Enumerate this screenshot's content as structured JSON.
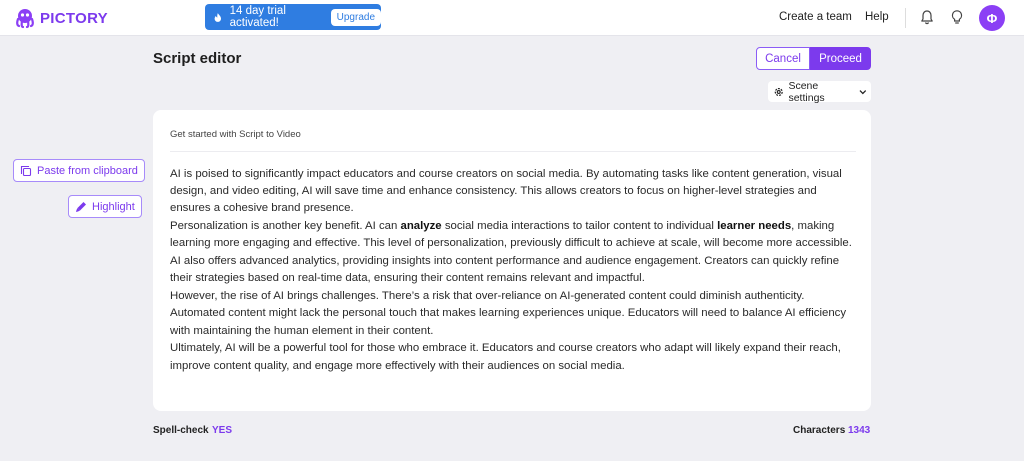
{
  "header": {
    "brand": "PICTORY",
    "trial_text": "14 day trial activated!",
    "upgrade_label": "Upgrade",
    "create_team_label": "Create a team",
    "help_label": "Help",
    "avatar_initial": "Φ"
  },
  "page": {
    "title": "Script editor",
    "cancel_label": "Cancel",
    "proceed_label": "Proceed",
    "scene_settings_label": "Scene settings"
  },
  "sidebar": {
    "paste_label": "Paste from clipboard",
    "highlight_label": "Highlight"
  },
  "editor": {
    "heading": "Get started with Script to Video",
    "paragraphs": [
      [
        {
          "text": "AI is poised to significantly impact educators and course creators on social media. By automating tasks like content generation, visual design, and video editing, AI will save time and enhance consistency. This allows creators to focus on higher-level strategies and ensures a cohesive brand presence.",
          "bold": false
        }
      ],
      [
        {
          "text": "Personalization is another key benefit. AI can ",
          "bold": false
        },
        {
          "text": "analyze",
          "bold": true
        },
        {
          "text": " social media interactions to tailor content to individual ",
          "bold": false
        },
        {
          "text": "learner needs",
          "bold": true
        },
        {
          "text": ", making learning more engaging and effective. This level of personalization, previously difficult to achieve at scale, will become more accessible.",
          "bold": false
        }
      ],
      [
        {
          "text": "AI also offers advanced analytics, providing insights into content performance and audience engagement. Creators can quickly refine their strategies based on real-time data, ensuring their content remains relevant and impactful.",
          "bold": false
        }
      ],
      [
        {
          "text": "However, the rise of AI brings challenges. There’s a risk that over-reliance on AI-generated content could diminish authenticity. Automated content might lack the personal touch that makes learning experiences unique. Educators will need to balance AI efficiency with maintaining the human element in their content.",
          "bold": false
        }
      ],
      [
        {
          "text": "Ultimately, AI will be a powerful tool for those who embrace it. Educators and course creators who adapt will likely expand their reach, improve content quality, and engage more effectively with their audiences on social media.",
          "bold": false
        }
      ]
    ]
  },
  "footer": {
    "spellcheck_label": "Spell-check",
    "spellcheck_value": "YES",
    "characters_label": "Characters",
    "characters_value": "1343"
  },
  "icons": {
    "logo": "octopus-logo-icon",
    "trial": "flame-icon",
    "bell": "bell-icon",
    "bulb": "lightbulb-icon",
    "gear": "gear-icon",
    "chevron": "chevron-down-icon",
    "paste": "copy-icon",
    "highlight": "marker-icon"
  },
  "colors": {
    "accent": "#7c3aed",
    "trial_banner": "#2f7de1",
    "background": "#efeff3"
  }
}
